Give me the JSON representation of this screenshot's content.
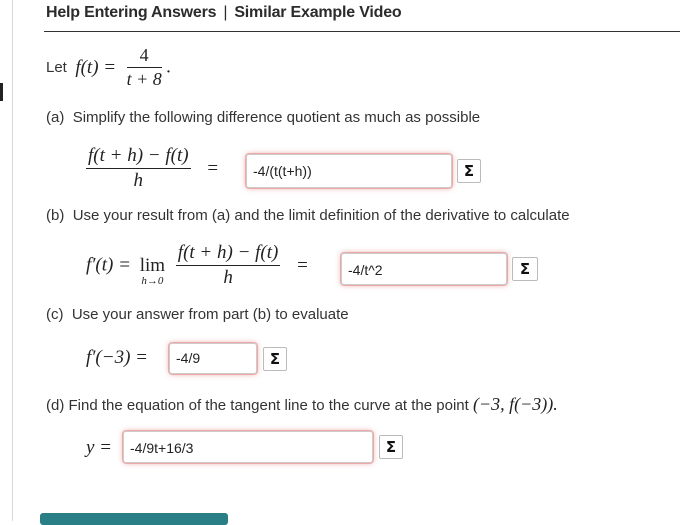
{
  "header": {
    "help_link": "Help Entering Answers",
    "separator": "|",
    "video_link": "Similar Example Video"
  },
  "problem": {
    "let_text": "Let",
    "function_lhs": "f(t) =",
    "numerator": "4",
    "denominator": "t + 8",
    "end_period": "."
  },
  "parts": {
    "a": {
      "label": "(a)",
      "instruction": "Simplify the following difference quotient as much as possible",
      "numerator": "f(t + h) − f(t)",
      "denominator": "h",
      "equals": "=",
      "answer": "-4/(t(t+h))"
    },
    "b": {
      "label": "(b)",
      "instruction": "Use your result from (a) and the limit definition of the derivative to calculate",
      "lhs": "f′(t) =",
      "lim": "lim",
      "lim_sub": "h→0",
      "numerator": "f(t + h) − f(t)",
      "denominator": "h",
      "equals": "=",
      "answer": "-4/t^2"
    },
    "c": {
      "label": "(c)",
      "instruction": "Use your answer from part (b) to evaluate",
      "lhs": "f′(−3) =",
      "answer": "-4/9"
    },
    "d": {
      "label": "(d)",
      "instruction": "Find the equation of the tangent line to the curve at the point",
      "point": "(−3, f(−3)).",
      "lhs": "y =",
      "answer": "-4/9t+16/3"
    }
  },
  "icons": {
    "equation_editor": "Σ"
  },
  "colors": {
    "input_glow": "#d9534f",
    "button": "#2a7f86",
    "header_rule": "#333333"
  }
}
